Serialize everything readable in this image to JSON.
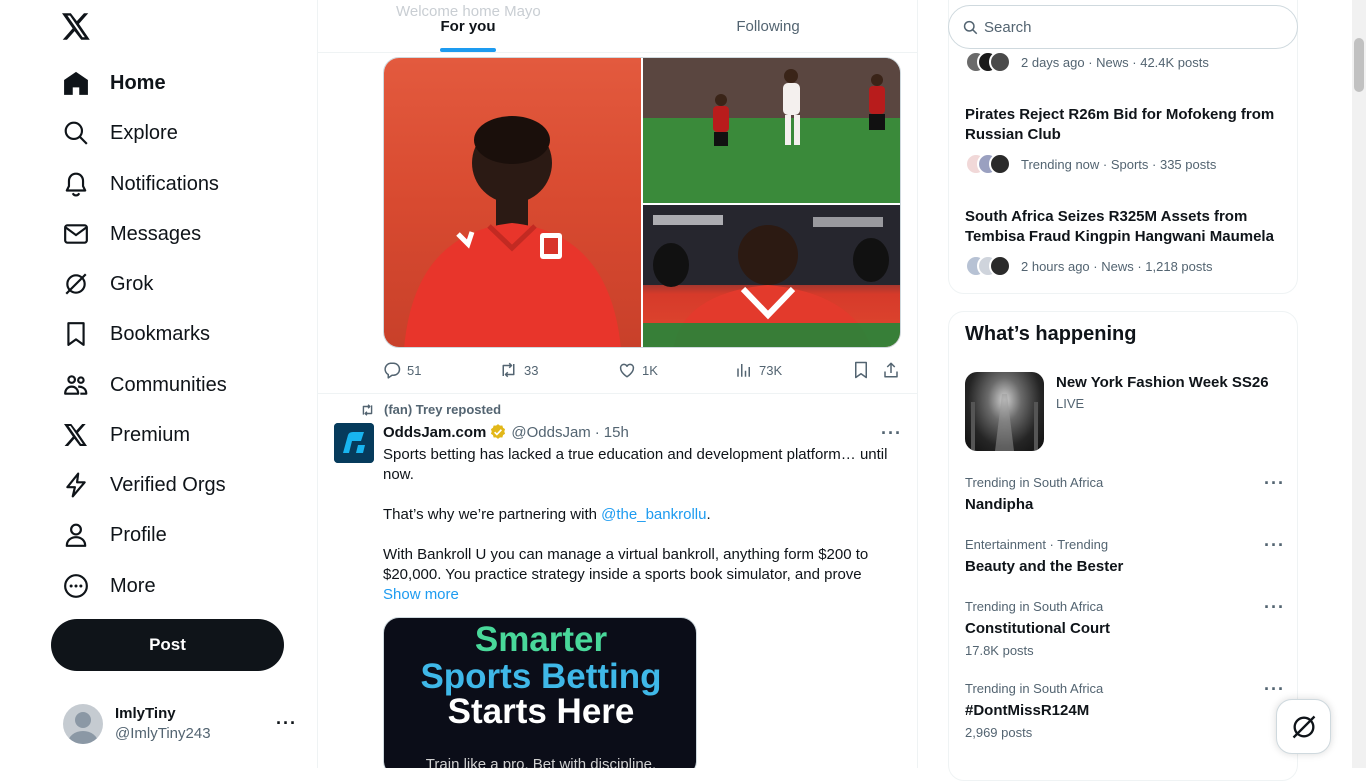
{
  "nav": {
    "items": [
      {
        "label": "Home",
        "icon": "home-icon"
      },
      {
        "label": "Explore",
        "icon": "search-icon"
      },
      {
        "label": "Notifications",
        "icon": "bell-icon"
      },
      {
        "label": "Messages",
        "icon": "envelope-icon"
      },
      {
        "label": "Grok",
        "icon": "grok-icon"
      },
      {
        "label": "Bookmarks",
        "icon": "bookmark-icon"
      },
      {
        "label": "Communities",
        "icon": "communities-icon"
      },
      {
        "label": "Premium",
        "icon": "x-logo-icon"
      },
      {
        "label": "Verified Orgs",
        "icon": "lightning-icon"
      },
      {
        "label": "Profile",
        "icon": "person-icon"
      },
      {
        "label": "More",
        "icon": "more-circle-icon"
      }
    ],
    "post_label": "Post",
    "account": {
      "name": "ImlyTiny",
      "handle": "@ImlyTiny243"
    }
  },
  "main": {
    "ghost_text": "Welcome home Mayo",
    "tabs": [
      {
        "label": "For you"
      },
      {
        "label": "Following"
      }
    ],
    "tweet1": {
      "replies": "51",
      "reposts": "33",
      "likes": "1K",
      "views": "73K"
    },
    "tweet2": {
      "repost_label": "(fan) Trey reposted",
      "name": "OddsJam.com",
      "handle": "@OddsJam",
      "time": "15h",
      "p1": "Sports betting has lacked a true education and development platform… until now.",
      "p2_pre": "That’s why we’re partnering with ",
      "p2_link": "@the_bankrollu",
      "p2_post": ".",
      "p3": "With Bankroll U you can manage a virtual bankroll, anything form $200 to $20,000. You practice strategy inside a sports book simulator, and prove",
      "show_more": "Show more",
      "ad_line1": "Smarter",
      "ad_line2": "Sports Betting",
      "ad_line3": "Starts Here",
      "ad_line4": "Train like a pro. Bet with discipline."
    }
  },
  "sidebar": {
    "search_placeholder": "Search",
    "news": [
      {
        "title": "",
        "meta": "2 days ago · News · 42.4K posts"
      },
      {
        "title": "Pirates Reject R26m Bid for Mofokeng from Russian Club",
        "meta": "Trending now · Sports · 335 posts"
      },
      {
        "title": "South Africa Seizes R325M Assets from Tembisa Fraud Kingpin Hangwani Maumela",
        "meta": "2 hours ago · News · 1,218 posts"
      }
    ],
    "happening": {
      "title": "What’s happening",
      "featured": {
        "title": "New York Fashion Week SS26",
        "status": "LIVE"
      },
      "trends": [
        {
          "category": "Trending in South Africa",
          "name": "Nandipha",
          "count": ""
        },
        {
          "category": "Entertainment · Trending",
          "name": "Beauty and the Bester",
          "count": ""
        },
        {
          "category": "Trending in South Africa",
          "name": "Constitutional Court",
          "count": "17.8K posts"
        },
        {
          "category": "Trending in South Africa",
          "name": "#DontMissR124M",
          "count": "2,969 posts"
        }
      ]
    }
  },
  "colors": {
    "accent": "#1d9bf0",
    "text": "#0f1419",
    "muted": "#536471",
    "border": "#eff3f4"
  }
}
